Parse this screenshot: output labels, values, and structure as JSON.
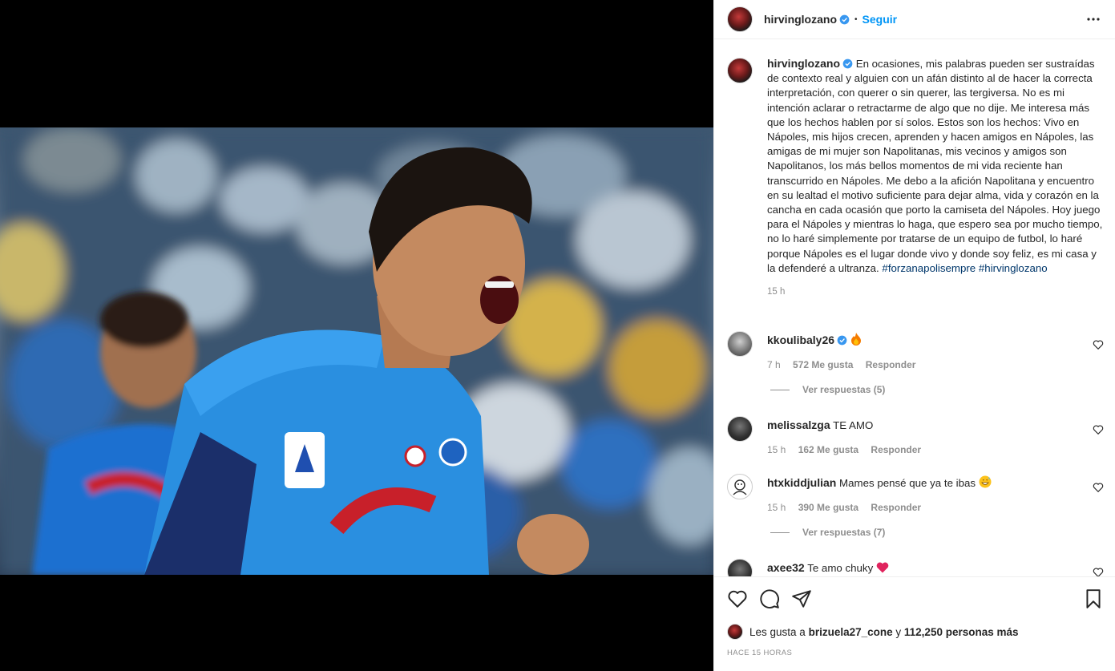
{
  "post": {
    "username": "hirvinglozano",
    "follow_label": "Seguir",
    "separator": "•",
    "caption": "En ocasiones, mis palabras pueden ser sustraídas de contexto real y alguien con un afán distinto al de hacer la correcta interpretación, con querer o sin querer, las tergiversa. No es mi intención aclarar o retractarme de algo que no dije. Me interesa más que los hechos hablen por sí solos. Estos son los hechos: Vivo en Nápoles, mis hijos crecen, aprenden y hacen amigos en Nápoles, las amigas de mi mujer son Napolitanas, mis vecinos y amigos son Napolitanos, los más bellos momentos de mi vida reciente han transcurrido en Nápoles. Me debo a la afición Napolitana y encuentro en su lealtad el motivo suficiente para dejar alma, vida y corazón en la cancha en cada ocasión que porto la camiseta del Nápoles. Hoy juego para el Nápoles y mientras lo haga, que espero sea por mucho tiempo, no lo haré simplemente por tratarse de un equipo de futbol, lo haré porque Nápoles es el lugar donde vivo y donde soy feliz, es mi casa y la defenderé a ultranza.",
    "hashtags": "#forzanapolisempre #hirvinglozano",
    "caption_time": "15 h"
  },
  "comments": [
    {
      "username": "kkoulibaly26",
      "text": "",
      "emoji": "fire-emoji",
      "time": "7 h",
      "likes": "572 Me gusta",
      "reply": "Responder",
      "replies": "Ver respuestas (5)"
    },
    {
      "username": "melissalzga",
      "text": "TE AMO",
      "time": "15 h",
      "likes": "162 Me gusta",
      "reply": "Responder"
    },
    {
      "username": "htxkiddjulian",
      "text": "Mames pensé que ya te ibas",
      "emoji": "grin-sweat-emoji",
      "time": "15 h",
      "likes": "390 Me gusta",
      "reply": "Responder",
      "replies": "Ver respuestas (7)"
    },
    {
      "username": "axee32",
      "text": "Te amo chuky",
      "emoji": "red-heart-emoji"
    }
  ],
  "footer": {
    "likes_prefix": "Les gusta a",
    "likes_user": "brizuela27_cone",
    "likes_mid": "y",
    "likes_rest": "112,250 personas más",
    "posted": "HACE 15 HORAS"
  },
  "colors": {
    "accent": "#0095f6",
    "hashtag": "#00376b",
    "muted": "#8e8e8e"
  }
}
